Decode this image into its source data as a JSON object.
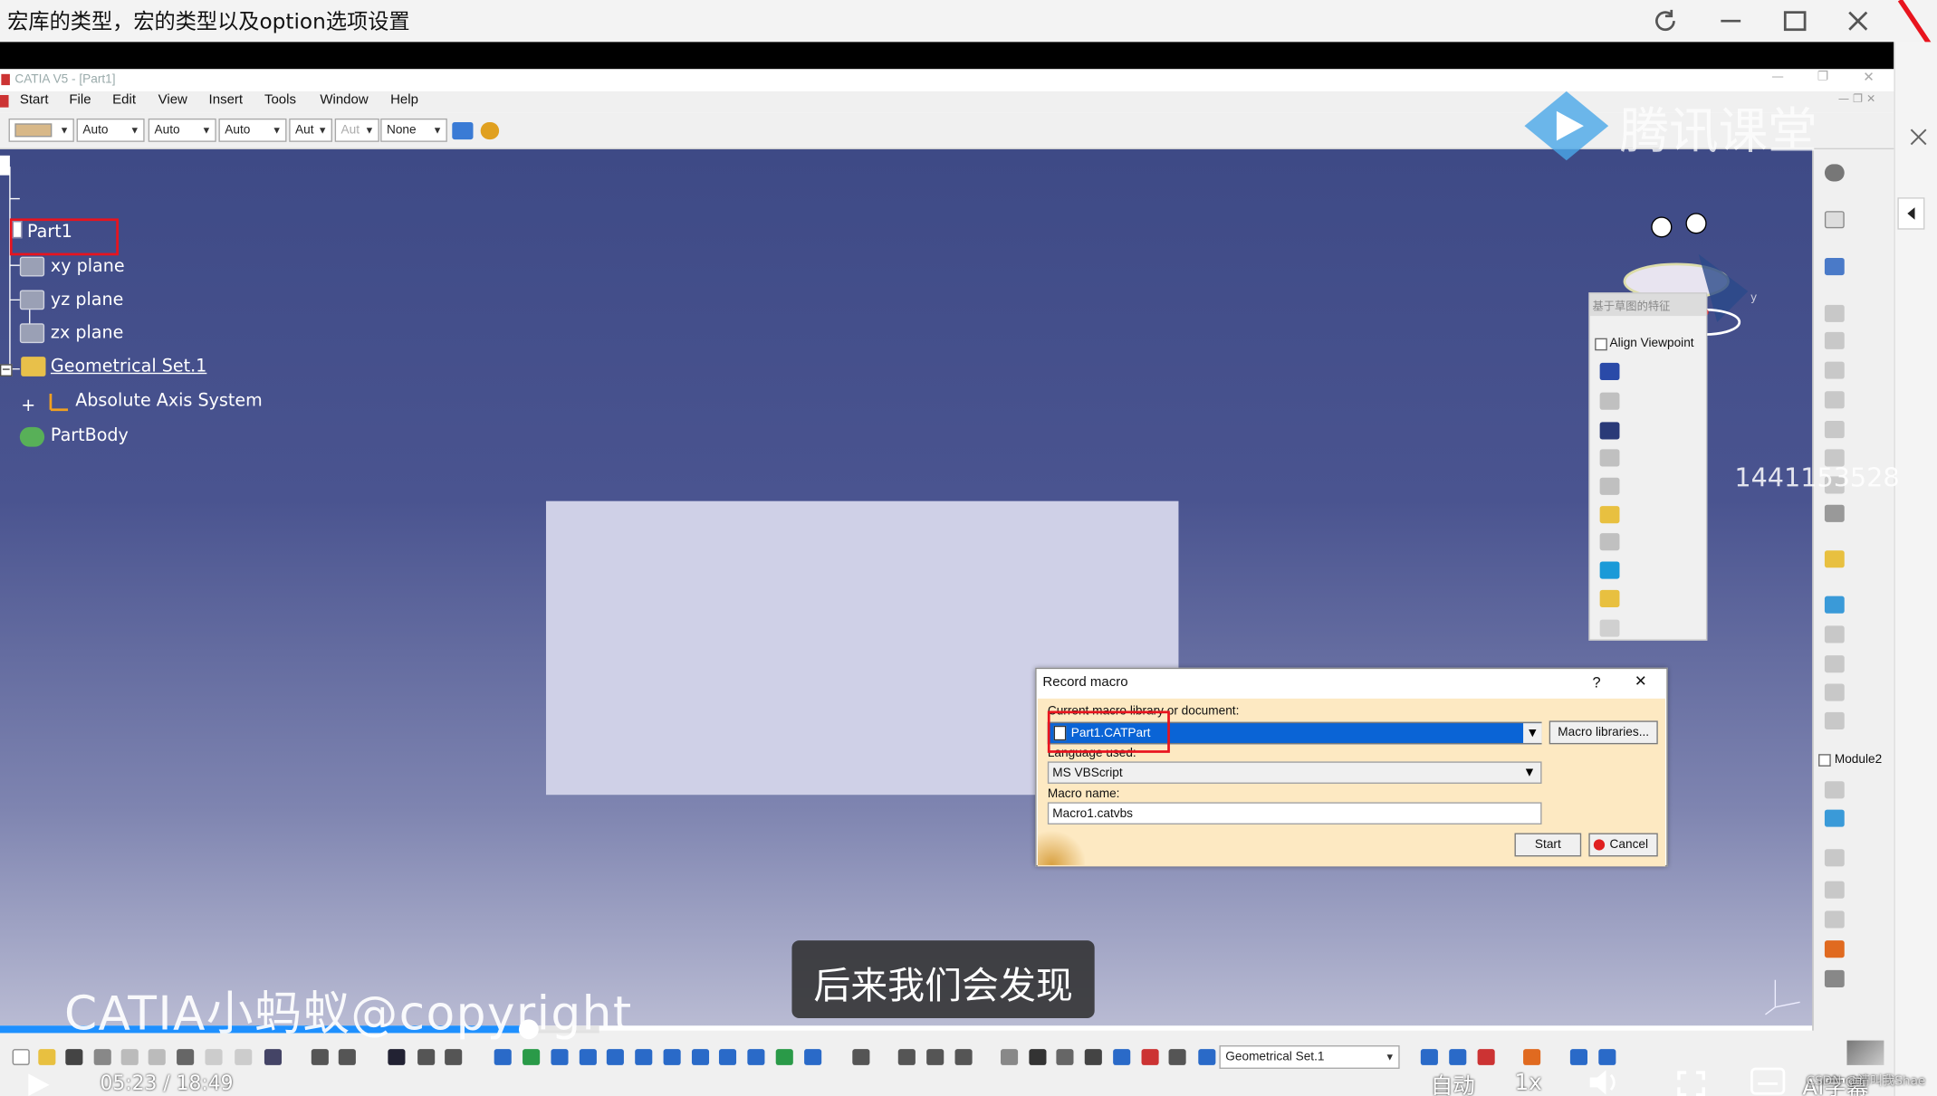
{
  "player": {
    "title": "宏库的类型，宏的类型以及option选项设置",
    "time": "05:23 / 18:49",
    "progress": 0.286,
    "auto_label": "自动",
    "speed_label": "1x",
    "ai_caption_label": "AI字幕",
    "subtitle": "后来我们会发现",
    "watermark_left": "CATIA小蚂蚁@copyright",
    "watermark_brand": "腾讯课堂",
    "watermark_number": "1441153528",
    "watermark_csdn": "CSDN @请叫我Shae"
  },
  "catia": {
    "window_title": "CATIA V5 - [Part1]",
    "menu": [
      "Start",
      "File",
      "Edit",
      "View",
      "Insert",
      "Tools",
      "Window",
      "Help"
    ],
    "toolbar_combos": [
      "Auto",
      "Auto",
      "Auto",
      "Aut",
      "Aut",
      "None"
    ],
    "tree": {
      "root": "Part1",
      "items": [
        "xy plane",
        "yz plane",
        "zx plane",
        "Geometrical Set.1",
        "Absolute Axis System",
        "PartBody"
      ]
    },
    "palette_title": "基于草图的特征",
    "align_viewpoint": "Align Viewpoint",
    "module_label": "Module2",
    "current_set": "Geometrical Set.1"
  },
  "dialog": {
    "title": "Record macro",
    "help": "?",
    "close": "✕",
    "library_label": "Current macro library or document:",
    "library_value": "Part1.CATPart",
    "macro_libraries_btn": "Macro libraries...",
    "language_label": "Language used:",
    "language_value": "MS VBScript",
    "name_label": "Macro name:",
    "name_value": "Macro1.catvbs",
    "start_btn": "Start",
    "cancel_btn": "Cancel"
  },
  "colors": {
    "highlight_red": "#e8141e",
    "selection_blue": "#0a64d6",
    "progress_blue": "#1e90ff",
    "dialog_body": "#fde9c2"
  }
}
